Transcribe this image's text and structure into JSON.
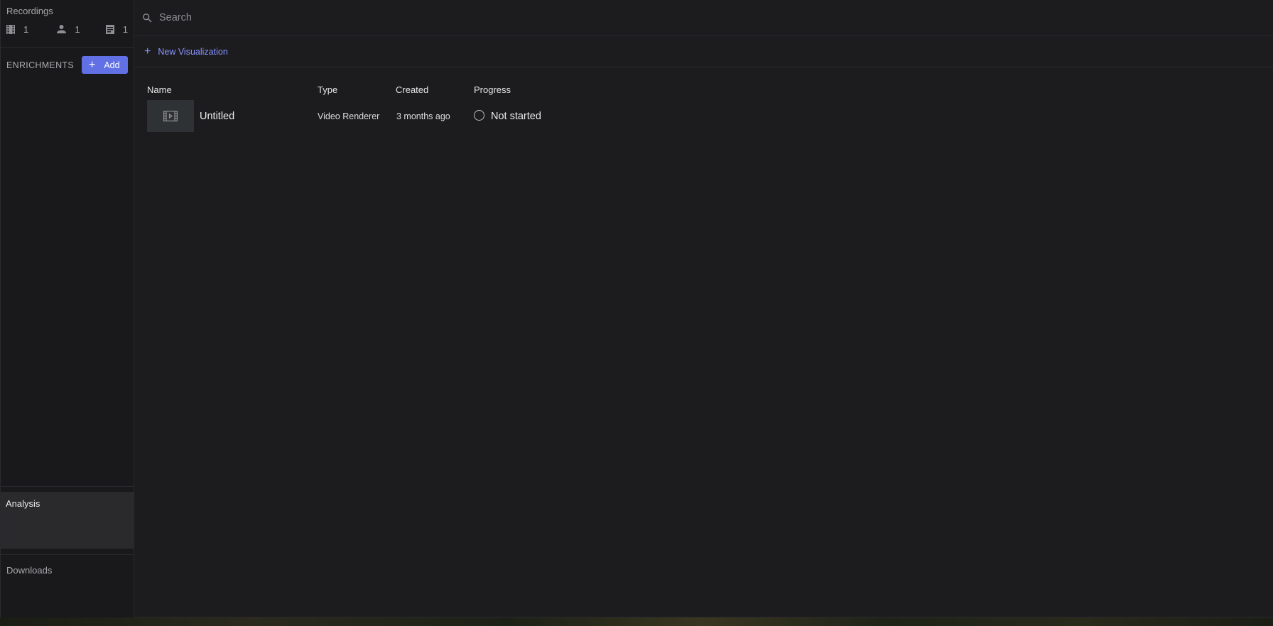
{
  "sidebar": {
    "recordings": {
      "title": "Recordings",
      "stats": [
        {
          "icon": "film-icon",
          "count": "1"
        },
        {
          "icon": "person-icon",
          "count": "1"
        },
        {
          "icon": "document-icon",
          "count": "1"
        }
      ]
    },
    "enrichments": {
      "label": "ENRICHMENTS",
      "add_label": "Add"
    },
    "analysis_label": "Analysis",
    "downloads_label": "Downloads"
  },
  "main": {
    "search": {
      "placeholder": "Search",
      "value": ""
    },
    "new_visualization_label": "New Visualization",
    "table": {
      "headers": {
        "name": "Name",
        "type": "Type",
        "created": "Created",
        "progress": "Progress"
      },
      "rows": [
        {
          "name": "Untitled",
          "type": "Video Renderer",
          "created": "3 months ago",
          "progress": "Not started",
          "thumbnail_icon": "video-file-icon"
        }
      ]
    }
  },
  "colors": {
    "accent": "#6270e6",
    "link": "#8a94ff",
    "background": "#1c1c1f",
    "sidebar": "#19191b",
    "selected": "#2a2a2c"
  }
}
